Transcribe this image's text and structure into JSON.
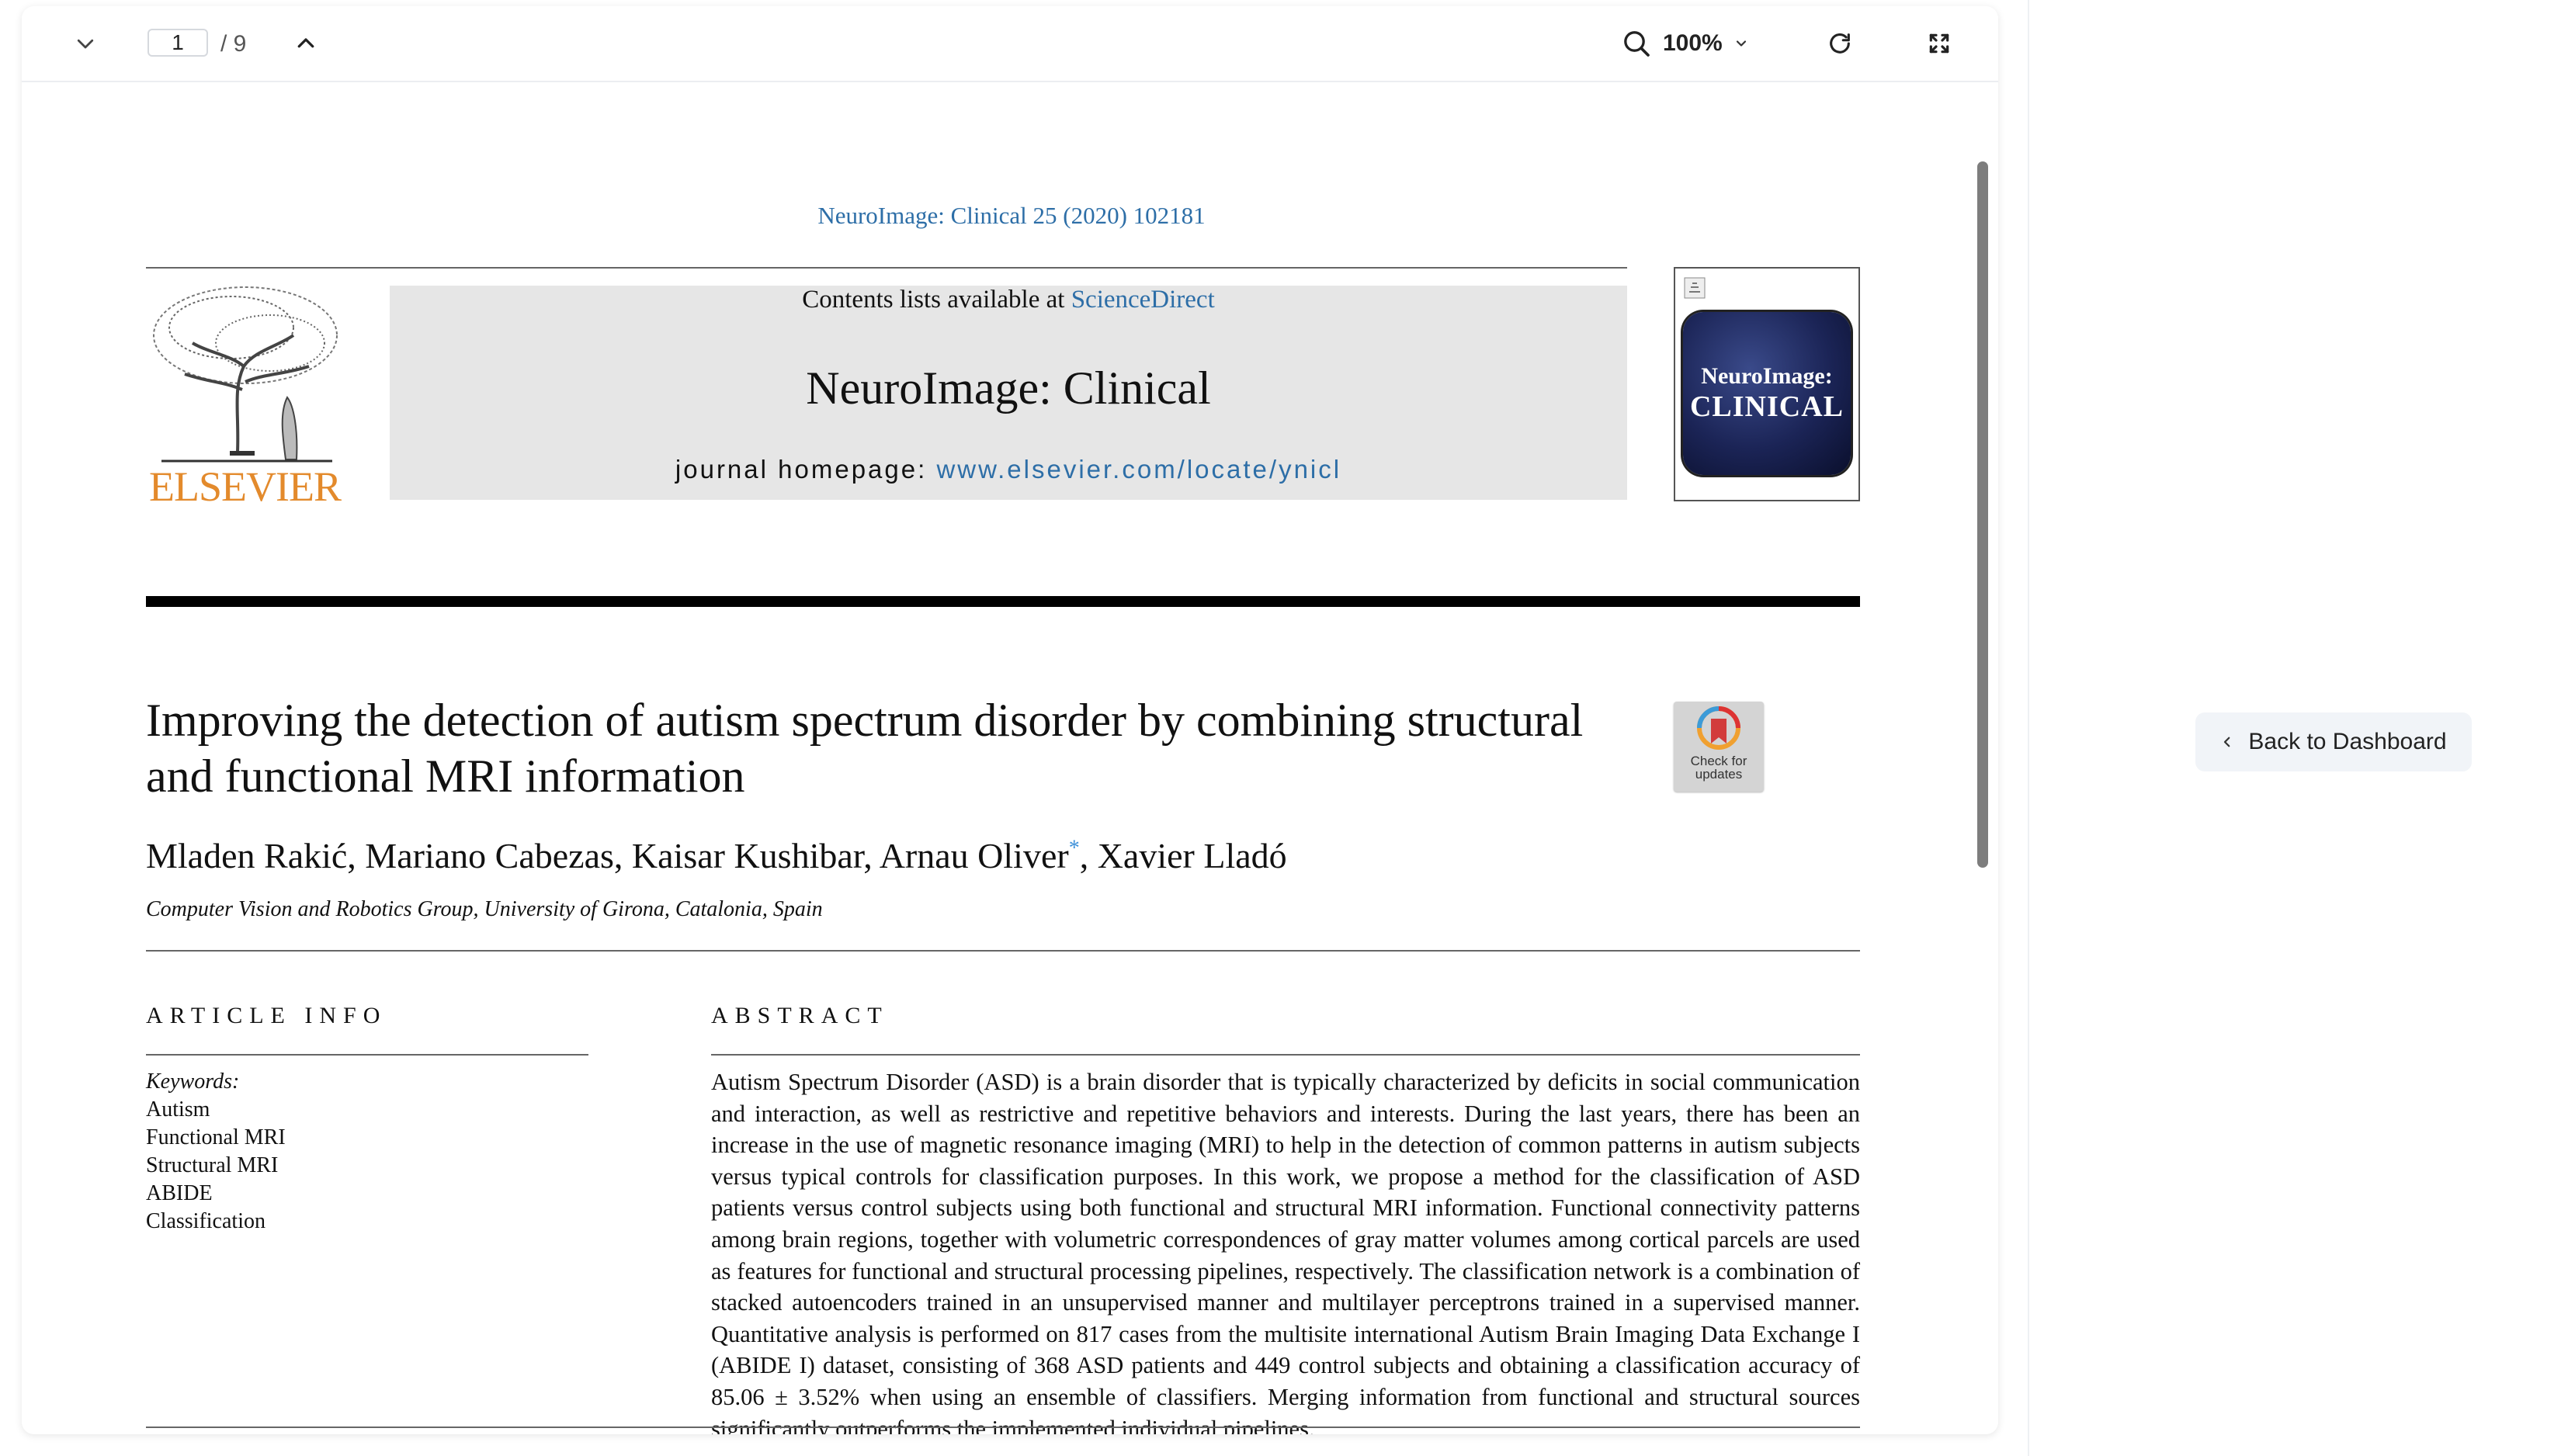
{
  "toolbar": {
    "page_current": "1",
    "page_total": "/ 9",
    "zoom": "100%",
    "icons": [
      "chevron-down-icon",
      "chevron-up-icon",
      "search-icon",
      "refresh-icon",
      "fullscreen-icon"
    ]
  },
  "side": {
    "back_label": "Back to Dashboard"
  },
  "pdf": {
    "journal_ref": "NeuroImage: Clinical 25 (2020) 102181",
    "contents_prefix": "Contents lists available at ",
    "contents_link": "ScienceDirect",
    "journal_name": "NeuroImage: Clinical",
    "homepage_prefix": "journal homepage: ",
    "homepage_link": "www.elsevier.com/locate/ynicl",
    "publisher": "ELSEVIER",
    "cover_line1": "NeuroImage:",
    "cover_line2": "CLINICAL",
    "badge_line1": "Check for",
    "badge_line2": "updates",
    "title": "Improving the detection of autism spectrum disorder by combining structural and functional MRI information",
    "authors_before_star": "Mladen Rakić, Mariano Cabezas, Kaisar Kushibar, Arnau Oliver",
    "author_star": "*",
    "authors_after_star": ", Xavier Lladó",
    "affiliation": "Computer Vision and Robotics Group, University of Girona, Catalonia, Spain",
    "article_info_heading": "ARTICLE INFO",
    "abstract_heading": "ABSTRACT",
    "keywords_heading": "Keywords:",
    "keywords": [
      "Autism",
      "Functional MRI",
      "Structural MRI",
      "ABIDE",
      "Classification"
    ],
    "abstract": "Autism Spectrum Disorder (ASD) is a brain disorder that is typically characterized by deficits in social communication and interaction, as well as restrictive and repetitive behaviors and interests. During the last years, there has been an increase in the use of magnetic resonance imaging (MRI) to help in the detection of common patterns in autism subjects versus typical controls for classification purposes. In this work, we propose a method for the classification of ASD patients versus control subjects using both functional and structural MRI information. Functional connectivity patterns among brain regions, together with volumetric correspondences of gray matter volumes among cortical parcels are used as features for functional and structural processing pipelines, respectively. The classification network is a combination of stacked autoencoders trained in an unsupervised manner and multilayer perceptrons trained in a supervised manner. Quantitative analysis is performed on 817 cases from the multisite international Autism Brain Imaging Data Exchange I (ABIDE I) dataset, consisting of 368 ASD patients and 449 control subjects and obtaining a classification accuracy of 85.06 ± 3.52% when using an ensemble of classifiers. Merging information from functional and structural sources significantly outperforms the implemented individual pipelines."
  },
  "colors": {
    "link": "#2d6ea7",
    "elsevier_orange": "#e38a2c",
    "banner_bg": "#e6e6e6"
  }
}
